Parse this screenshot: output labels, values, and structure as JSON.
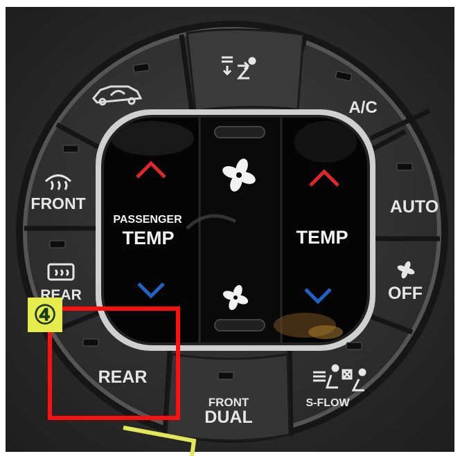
{
  "colors": {
    "surround": "#2b2b2b",
    "panel": "#333333",
    "rim": "#c8c8c8",
    "inner": "#050505",
    "up_arrow": "#e0252c",
    "down_arrow": "#1f63c9",
    "indicator": "#0d0d0d",
    "highlight_box": "#ff1010",
    "badge": "#e7ec4e",
    "pointer_line": "#e2e85a"
  },
  "buttons": {
    "recirc": {
      "icon": "car-recirculate-icon"
    },
    "fresh_air": {
      "icon": "fresh-air-intake-icon"
    },
    "ac": {
      "label": "A/C"
    },
    "auto": {
      "label": "AUTO"
    },
    "fan_off": {
      "label": "OFF",
      "icon": "fan-icon"
    },
    "s_flow": {
      "label": "S-FLOW",
      "icon": "seat-airflow-icon"
    },
    "front_dual": {
      "small_label": "FRONT",
      "label": "DUAL"
    },
    "rear": {
      "label": "REAR"
    },
    "rear_defrost": {
      "label": "REAR",
      "icon": "rear-defrost-icon"
    },
    "front_defrost": {
      "label": "FRONT",
      "icon": "front-defrost-icon"
    }
  },
  "center": {
    "passenger_small": "PASSENGER",
    "passenger_temp": "TEMP",
    "driver_temp": "TEMP",
    "fan_up_icon": "fan-icon",
    "fan_down_icon": "fan-icon",
    "temp_up_icon": "chevron-up-icon",
    "temp_down_icon": "chevron-down-icon"
  },
  "annotation": {
    "badge_label": "④"
  }
}
